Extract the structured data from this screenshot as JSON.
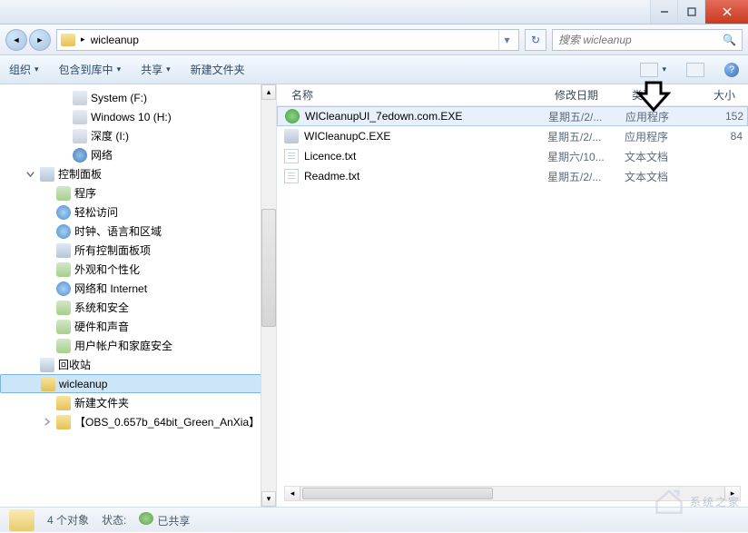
{
  "titlebar": {
    "min": "—",
    "max": "▭",
    "close": "✕"
  },
  "nav": {
    "path": "wicleanup",
    "search_placeholder": "搜索 wicleanup"
  },
  "toolbar": {
    "organize": "组织",
    "include": "包含到库中",
    "share": "共享",
    "new_folder": "新建文件夹"
  },
  "columns": {
    "name": "名称",
    "date": "修改日期",
    "type": "类型",
    "size": "大小"
  },
  "tree": [
    {
      "indent": 3,
      "twist": "",
      "icon": "drive",
      "label": "System (F:)"
    },
    {
      "indent": 3,
      "twist": "",
      "icon": "drive",
      "label": "Windows 10 (H:)"
    },
    {
      "indent": 3,
      "twist": "",
      "icon": "drive",
      "label": "深度 (I:)"
    },
    {
      "indent": 3,
      "twist": "",
      "icon": "network",
      "label": "网络"
    },
    {
      "indent": 1,
      "twist": "open",
      "icon": "cp",
      "label": "控制面板"
    },
    {
      "indent": 2,
      "twist": "",
      "icon": "generic",
      "label": "程序"
    },
    {
      "indent": 2,
      "twist": "",
      "icon": "blue",
      "label": "轻松访问"
    },
    {
      "indent": 2,
      "twist": "",
      "icon": "blue",
      "label": "时钟、语言和区域"
    },
    {
      "indent": 2,
      "twist": "",
      "icon": "cp",
      "label": "所有控制面板项"
    },
    {
      "indent": 2,
      "twist": "",
      "icon": "generic",
      "label": "外观和个性化"
    },
    {
      "indent": 2,
      "twist": "",
      "icon": "blue",
      "label": "网络和 Internet"
    },
    {
      "indent": 2,
      "twist": "",
      "icon": "generic",
      "label": "系统和安全"
    },
    {
      "indent": 2,
      "twist": "",
      "icon": "generic",
      "label": "硬件和声音"
    },
    {
      "indent": 2,
      "twist": "",
      "icon": "generic",
      "label": "用户帐户和家庭安全"
    },
    {
      "indent": 1,
      "twist": "",
      "icon": "recycle",
      "label": "回收站"
    },
    {
      "indent": 1,
      "twist": "",
      "icon": "folder",
      "label": "wicleanup",
      "selected": true
    },
    {
      "indent": 2,
      "twist": "",
      "icon": "folder",
      "label": "新建文件夹"
    },
    {
      "indent": 2,
      "twist": "closed",
      "icon": "folder",
      "label": "【OBS_0.657b_64bit_Green_AnXia】"
    }
  ],
  "files": [
    {
      "icon": "exe1",
      "name": "WICleanupUI_7edown.com.EXE",
      "date": "星期五/2/...",
      "type": "应用程序",
      "size": "152",
      "selected": true
    },
    {
      "icon": "exe2",
      "name": "WICleanupC.EXE",
      "date": "星期五/2/...",
      "type": "应用程序",
      "size": "84"
    },
    {
      "icon": "txt",
      "name": "Licence.txt",
      "date": "星期六/10...",
      "type": "文本文档",
      "size": ""
    },
    {
      "icon": "txt",
      "name": "Readme.txt",
      "date": "星期五/2/...",
      "type": "文本文档",
      "size": ""
    }
  ],
  "status": {
    "count": "4 个对象",
    "state_label": "状态:",
    "shared": "已共享"
  },
  "watermark": "系统之家"
}
